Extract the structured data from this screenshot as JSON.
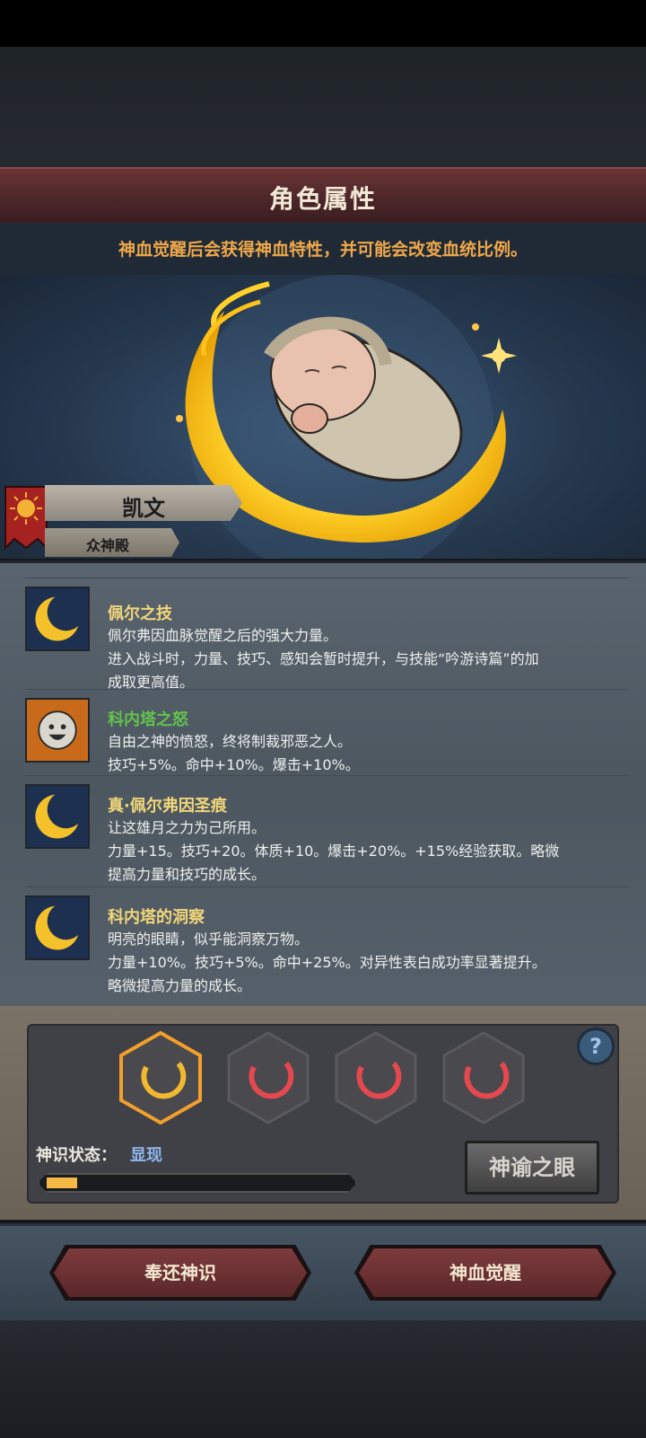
{
  "header": {
    "title": "角色属性"
  },
  "notice": "神血觉醒后会获得神血特性，并可能会改变血统比例。",
  "character": {
    "name": "凯文",
    "faction": "众神殿"
  },
  "traits": [
    {
      "name": "佩尔之技",
      "icon": "crescent-moon-icon",
      "color": "gold",
      "desc": [
        "佩尔弗因血脉觉醒之后的强大力量。",
        "进入战斗时，力量、技巧、感知会暂时提升，与技能“吟游诗篇”的加",
        "成取更高值。"
      ]
    },
    {
      "name": "科内塔之怒",
      "icon": "smiley-sun-icon",
      "color": "green",
      "desc": [
        "自由之神的愤怒，终将制裁邪恶之人。",
        "技巧+5%。命中+10%。爆击+10%。"
      ]
    },
    {
      "name": "真·佩尔弗因圣痕",
      "icon": "crescent-moon-icon",
      "color": "gold",
      "desc": [
        "让这雄月之力为己所用。",
        "力量+15。技巧+20。体质+10。爆击+20%。+15%经验获取。略微",
        "提高力量和技巧的成长。"
      ]
    },
    {
      "name": "科内塔的洞察",
      "icon": "crescent-moon-icon",
      "color": "gold",
      "desc": [
        "明亮的眼睛，似乎能洞察万物。",
        "力量+10%。技巧+5%。命中+25%。对异性表白成功率显著提升。",
        "略微提高力量的成长。"
      ]
    }
  ],
  "awakening": {
    "status_label": "神识状态：",
    "status_value": "显现",
    "progress_fraction": 0.1,
    "help_label": "?",
    "oracle_button": "神谕之眼",
    "slots": [
      {
        "state": "active",
        "color": "#f2b92e"
      },
      {
        "state": "locked",
        "color": "#e5484f"
      },
      {
        "state": "locked",
        "color": "#e5484f"
      },
      {
        "state": "locked",
        "color": "#e5484f"
      }
    ]
  },
  "actions": {
    "return_button": "奉还神识",
    "awaken_button": "神血觉醒"
  }
}
